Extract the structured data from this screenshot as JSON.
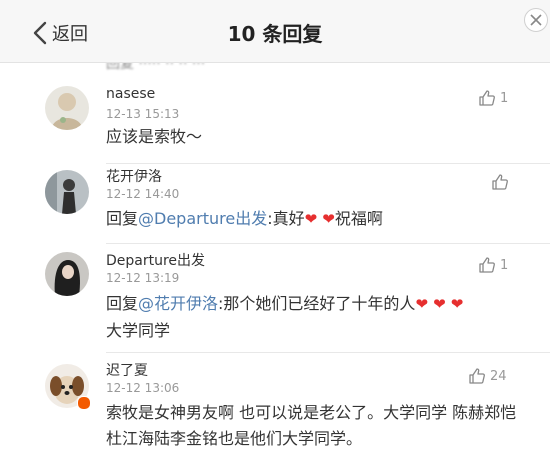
{
  "header": {
    "back_label": "返回",
    "title": "10 条回复"
  },
  "icons": {
    "back": "chevron-left-icon",
    "close": "close-icon",
    "like": "thumbs-up-icon",
    "heart": "heart-icon"
  },
  "colors": {
    "mention": "#507daf",
    "heart": "#e62f2f",
    "vip_badge": "#f35a00",
    "muted_text": "#999999"
  },
  "comments": [
    {
      "username": "nasese",
      "time": "12-13 15:13",
      "likes": "1",
      "text": "应该是索牧～"
    },
    {
      "username": "花开伊洛",
      "time": "12-12 14:40",
      "likes": "",
      "reply_prefix": "回复",
      "mention": "@Departure出发",
      "text_after_mention": ":真好",
      "heart_glyph": "❤",
      "text_after_hearts": "祝福啊"
    },
    {
      "username": "Departure出发",
      "time": "12-12 13:19",
      "likes": "1",
      "reply_prefix": "回复",
      "mention": "@花开伊洛",
      "text_after_mention": ":那个她们已经好了十年的人",
      "heart_glyph": "❤",
      "text_line2": "大学同学"
    },
    {
      "username": "迟了夏",
      "time": "12-12 13:06",
      "likes": "24",
      "text": "索牧是女神男友啊 也可以说是老公了。大学同学 陈赫郑恺杜江海陆李金铭也是他们大学同学。"
    }
  ]
}
